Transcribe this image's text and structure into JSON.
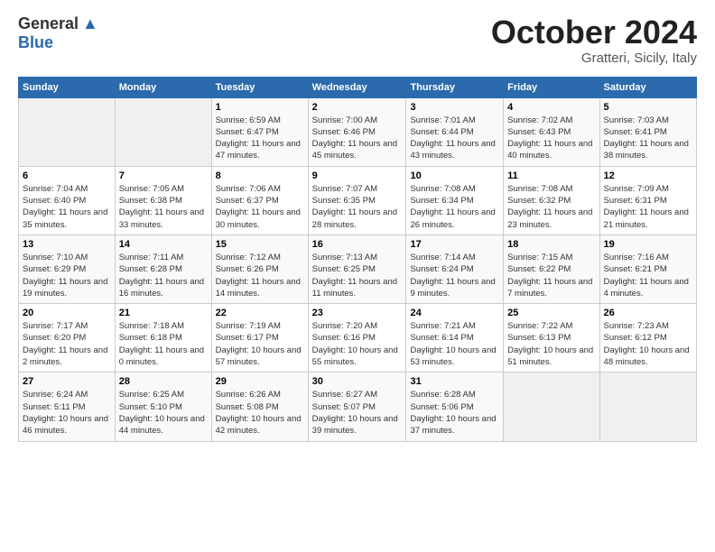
{
  "header": {
    "logo_general": "General",
    "logo_blue": "Blue",
    "title": "October 2024",
    "subtitle": "Gratteri, Sicily, Italy"
  },
  "days_of_week": [
    "Sunday",
    "Monday",
    "Tuesday",
    "Wednesday",
    "Thursday",
    "Friday",
    "Saturday"
  ],
  "weeks": [
    [
      {
        "day": "",
        "empty": true
      },
      {
        "day": "",
        "empty": true
      },
      {
        "day": "1",
        "sunrise": "Sunrise: 6:59 AM",
        "sunset": "Sunset: 6:47 PM",
        "daylight": "Daylight: 11 hours and 47 minutes."
      },
      {
        "day": "2",
        "sunrise": "Sunrise: 7:00 AM",
        "sunset": "Sunset: 6:46 PM",
        "daylight": "Daylight: 11 hours and 45 minutes."
      },
      {
        "day": "3",
        "sunrise": "Sunrise: 7:01 AM",
        "sunset": "Sunset: 6:44 PM",
        "daylight": "Daylight: 11 hours and 43 minutes."
      },
      {
        "day": "4",
        "sunrise": "Sunrise: 7:02 AM",
        "sunset": "Sunset: 6:43 PM",
        "daylight": "Daylight: 11 hours and 40 minutes."
      },
      {
        "day": "5",
        "sunrise": "Sunrise: 7:03 AM",
        "sunset": "Sunset: 6:41 PM",
        "daylight": "Daylight: 11 hours and 38 minutes."
      }
    ],
    [
      {
        "day": "6",
        "sunrise": "Sunrise: 7:04 AM",
        "sunset": "Sunset: 6:40 PM",
        "daylight": "Daylight: 11 hours and 35 minutes."
      },
      {
        "day": "7",
        "sunrise": "Sunrise: 7:05 AM",
        "sunset": "Sunset: 6:38 PM",
        "daylight": "Daylight: 11 hours and 33 minutes."
      },
      {
        "day": "8",
        "sunrise": "Sunrise: 7:06 AM",
        "sunset": "Sunset: 6:37 PM",
        "daylight": "Daylight: 11 hours and 30 minutes."
      },
      {
        "day": "9",
        "sunrise": "Sunrise: 7:07 AM",
        "sunset": "Sunset: 6:35 PM",
        "daylight": "Daylight: 11 hours and 28 minutes."
      },
      {
        "day": "10",
        "sunrise": "Sunrise: 7:08 AM",
        "sunset": "Sunset: 6:34 PM",
        "daylight": "Daylight: 11 hours and 26 minutes."
      },
      {
        "day": "11",
        "sunrise": "Sunrise: 7:08 AM",
        "sunset": "Sunset: 6:32 PM",
        "daylight": "Daylight: 11 hours and 23 minutes."
      },
      {
        "day": "12",
        "sunrise": "Sunrise: 7:09 AM",
        "sunset": "Sunset: 6:31 PM",
        "daylight": "Daylight: 11 hours and 21 minutes."
      }
    ],
    [
      {
        "day": "13",
        "sunrise": "Sunrise: 7:10 AM",
        "sunset": "Sunset: 6:29 PM",
        "daylight": "Daylight: 11 hours and 19 minutes."
      },
      {
        "day": "14",
        "sunrise": "Sunrise: 7:11 AM",
        "sunset": "Sunset: 6:28 PM",
        "daylight": "Daylight: 11 hours and 16 minutes."
      },
      {
        "day": "15",
        "sunrise": "Sunrise: 7:12 AM",
        "sunset": "Sunset: 6:26 PM",
        "daylight": "Daylight: 11 hours and 14 minutes."
      },
      {
        "day": "16",
        "sunrise": "Sunrise: 7:13 AM",
        "sunset": "Sunset: 6:25 PM",
        "daylight": "Daylight: 11 hours and 11 minutes."
      },
      {
        "day": "17",
        "sunrise": "Sunrise: 7:14 AM",
        "sunset": "Sunset: 6:24 PM",
        "daylight": "Daylight: 11 hours and 9 minutes."
      },
      {
        "day": "18",
        "sunrise": "Sunrise: 7:15 AM",
        "sunset": "Sunset: 6:22 PM",
        "daylight": "Daylight: 11 hours and 7 minutes."
      },
      {
        "day": "19",
        "sunrise": "Sunrise: 7:16 AM",
        "sunset": "Sunset: 6:21 PM",
        "daylight": "Daylight: 11 hours and 4 minutes."
      }
    ],
    [
      {
        "day": "20",
        "sunrise": "Sunrise: 7:17 AM",
        "sunset": "Sunset: 6:20 PM",
        "daylight": "Daylight: 11 hours and 2 minutes."
      },
      {
        "day": "21",
        "sunrise": "Sunrise: 7:18 AM",
        "sunset": "Sunset: 6:18 PM",
        "daylight": "Daylight: 11 hours and 0 minutes."
      },
      {
        "day": "22",
        "sunrise": "Sunrise: 7:19 AM",
        "sunset": "Sunset: 6:17 PM",
        "daylight": "Daylight: 10 hours and 57 minutes."
      },
      {
        "day": "23",
        "sunrise": "Sunrise: 7:20 AM",
        "sunset": "Sunset: 6:16 PM",
        "daylight": "Daylight: 10 hours and 55 minutes."
      },
      {
        "day": "24",
        "sunrise": "Sunrise: 7:21 AM",
        "sunset": "Sunset: 6:14 PM",
        "daylight": "Daylight: 10 hours and 53 minutes."
      },
      {
        "day": "25",
        "sunrise": "Sunrise: 7:22 AM",
        "sunset": "Sunset: 6:13 PM",
        "daylight": "Daylight: 10 hours and 51 minutes."
      },
      {
        "day": "26",
        "sunrise": "Sunrise: 7:23 AM",
        "sunset": "Sunset: 6:12 PM",
        "daylight": "Daylight: 10 hours and 48 minutes."
      }
    ],
    [
      {
        "day": "27",
        "sunrise": "Sunrise: 6:24 AM",
        "sunset": "Sunset: 5:11 PM",
        "daylight": "Daylight: 10 hours and 46 minutes."
      },
      {
        "day": "28",
        "sunrise": "Sunrise: 6:25 AM",
        "sunset": "Sunset: 5:10 PM",
        "daylight": "Daylight: 10 hours and 44 minutes."
      },
      {
        "day": "29",
        "sunrise": "Sunrise: 6:26 AM",
        "sunset": "Sunset: 5:08 PM",
        "daylight": "Daylight: 10 hours and 42 minutes."
      },
      {
        "day": "30",
        "sunrise": "Sunrise: 6:27 AM",
        "sunset": "Sunset: 5:07 PM",
        "daylight": "Daylight: 10 hours and 39 minutes."
      },
      {
        "day": "31",
        "sunrise": "Sunrise: 6:28 AM",
        "sunset": "Sunset: 5:06 PM",
        "daylight": "Daylight: 10 hours and 37 minutes."
      },
      {
        "day": "",
        "empty": true
      },
      {
        "day": "",
        "empty": true
      }
    ]
  ]
}
